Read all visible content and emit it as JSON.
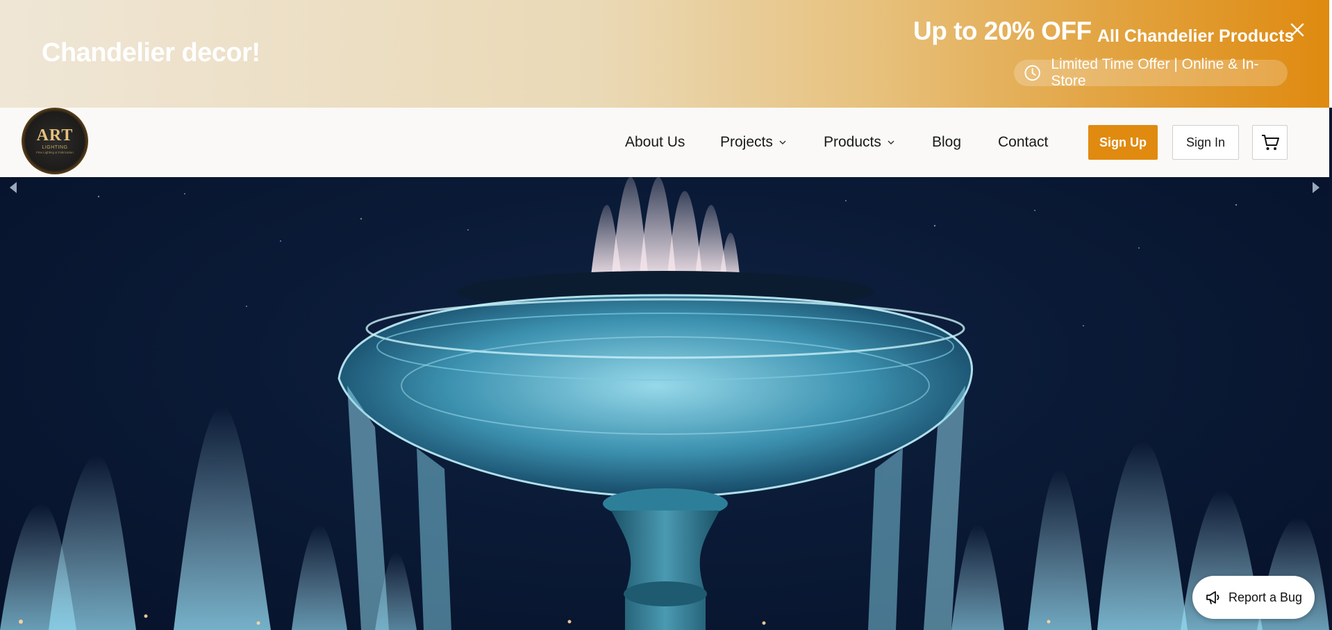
{
  "promo": {
    "title": "Chandelier decor!",
    "headline": "Up to 20% OFF",
    "subheadline": "All Chandelier Products",
    "offer_note": "Limited Time Offer | Online & In-Store",
    "close_icon": "close-icon",
    "clock_icon": "clock-icon"
  },
  "logo": {
    "mark": "ART",
    "sub": "LIGHTING",
    "tag": "Fine Lighting & Fabrication"
  },
  "nav": {
    "items": [
      {
        "label": "About Us"
      },
      {
        "label": "Projects",
        "has_dropdown": true
      },
      {
        "label": "Products",
        "has_dropdown": true
      },
      {
        "label": "Blog"
      },
      {
        "label": "Contact"
      }
    ],
    "sign_up": "Sign Up",
    "sign_in": "Sign In",
    "cart_icon": "cart-icon"
  },
  "hero": {
    "image": "illuminated fountain at night",
    "prev_icon": "chevron-left-icon",
    "next_icon": "chevron-right-icon"
  },
  "report_bug": {
    "label": "Report a Bug",
    "icon": "megaphone-icon"
  },
  "colors": {
    "accent": "#e08a10",
    "banner_start": "#efe6d6",
    "banner_end": "#df8a10",
    "nav_bg": "#faf9f7",
    "hero_bg": "#0a1a36"
  }
}
